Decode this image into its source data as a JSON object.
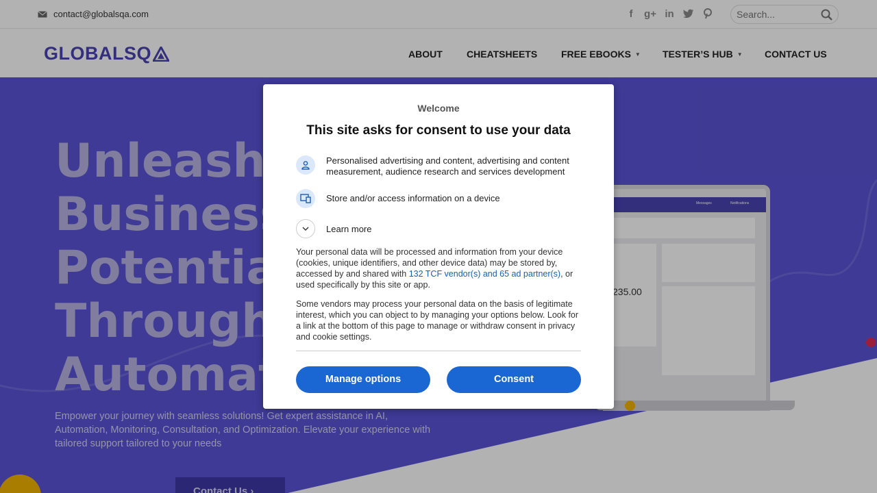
{
  "topbar": {
    "email": "contact@globalsqa.com",
    "social": [
      "facebook-icon",
      "googleplus-icon",
      "linkedin-icon",
      "twitter-icon",
      "pinterest-icon"
    ],
    "search_placeholder": "Search..."
  },
  "header": {
    "logo": "GLOBALSQ",
    "nav": [
      {
        "label": "ABOUT",
        "has_dropdown": false
      },
      {
        "label": "CHEATSHEETS",
        "has_dropdown": false
      },
      {
        "label": "FREE EBOOKS",
        "has_dropdown": true
      },
      {
        "label": "TESTER’S HUB",
        "has_dropdown": true
      },
      {
        "label": "CONTACT US",
        "has_dropdown": false
      }
    ]
  },
  "hero": {
    "headline": [
      "Unleash",
      "Business",
      "Potential",
      "Through",
      "Automation"
    ],
    "subtext": "Empower your journey with seamless solutions! Get expert assistance in AI, Automation, Monitoring, Consultation, and Optimization. Elevate your experience with tailored support tailored to your needs",
    "cta": "Contact Us",
    "mockup": {
      "tab1": "Messages",
      "tab2": "Notifications",
      "amount": "235.00"
    }
  },
  "consent": {
    "welcome": "Welcome",
    "title": "This site asks for consent to use your data",
    "purposes": [
      {
        "icon": "person-icon",
        "text": "Personalised advertising and content, advertising and content measurement, audience research and services development"
      },
      {
        "icon": "device-icon",
        "text": "Store and/or access information on a device"
      }
    ],
    "learn_more": "Learn more",
    "para1_before": "Your personal data will be processed and information from your device (cookies, unique identifiers, and other device data) may be stored by, accessed by and shared with ",
    "para1_link": "132 TCF vendor(s) and 65 ad partner(s)",
    "para1_after": ", or used specifically by this site or app.",
    "para2": "Some vendors may process your personal data on the basis of legitimate interest, which you can object to by managing your options below. Look for a link at the bottom of this page to manage or withdraw consent in privacy and cookie settings.",
    "manage_button": "Manage options",
    "consent_button": "Consent"
  },
  "colors": {
    "brand": "#4b44b3",
    "hero": "#5a54d6",
    "button": "#1a66d2",
    "link": "#1a5fb4"
  }
}
